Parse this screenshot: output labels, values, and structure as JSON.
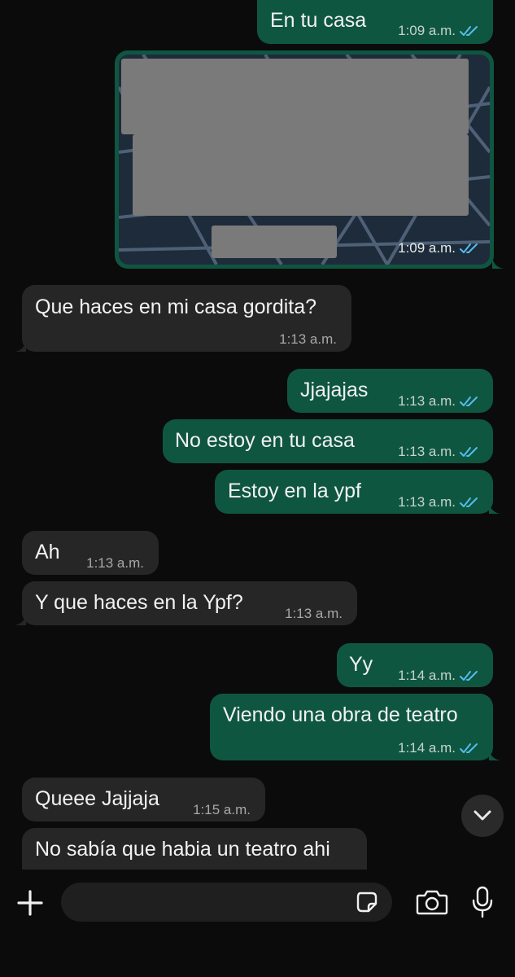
{
  "messages": [
    {
      "id": "m1",
      "dir": "out",
      "text": "En tu casa",
      "time": "1:09 a.m.",
      "status": "read"
    },
    {
      "id": "m2",
      "dir": "out",
      "type": "location",
      "time": "1:09 a.m.",
      "status": "read"
    },
    {
      "id": "m3",
      "dir": "in",
      "text": "Que haces en mi casa gordita?",
      "time": "1:13 a.m."
    },
    {
      "id": "m4",
      "dir": "out",
      "text": "Jjajajas",
      "time": "1:13 a.m.",
      "status": "read"
    },
    {
      "id": "m5",
      "dir": "out",
      "text": "No estoy en tu casa",
      "time": "1:13 a.m.",
      "status": "read"
    },
    {
      "id": "m6",
      "dir": "out",
      "text": "Estoy en la ypf",
      "time": "1:13 a.m.",
      "status": "read"
    },
    {
      "id": "m7",
      "dir": "in",
      "text": "Ah",
      "time": "1:13 a.m."
    },
    {
      "id": "m8",
      "dir": "in",
      "text": "Y que haces en la Ypf?",
      "time": "1:13 a.m."
    },
    {
      "id": "m9",
      "dir": "out",
      "text": "Yy",
      "time": "1:14 a.m.",
      "status": "read"
    },
    {
      "id": "m10",
      "dir": "out",
      "text": "Viendo una obra de teatro",
      "time": "1:14 a.m.",
      "status": "read"
    },
    {
      "id": "m11",
      "dir": "in",
      "text": "Queee Jajjaja",
      "time": "1:15 a.m."
    },
    {
      "id": "m12",
      "dir": "in",
      "text": "No sabía que habia un teatro ahi",
      "time": ""
    }
  ],
  "composer": {
    "placeholder": "",
    "icons": [
      "plus-icon",
      "sticker-icon",
      "camera-icon",
      "microphone-icon"
    ]
  },
  "scroll_button": {
    "icon": "chevron-down-icon"
  },
  "colors": {
    "background": "#0b0b0b",
    "outgoing_bubble": "#0f5640",
    "incoming_bubble": "#262626",
    "read_ticks": "#53bdeb"
  }
}
